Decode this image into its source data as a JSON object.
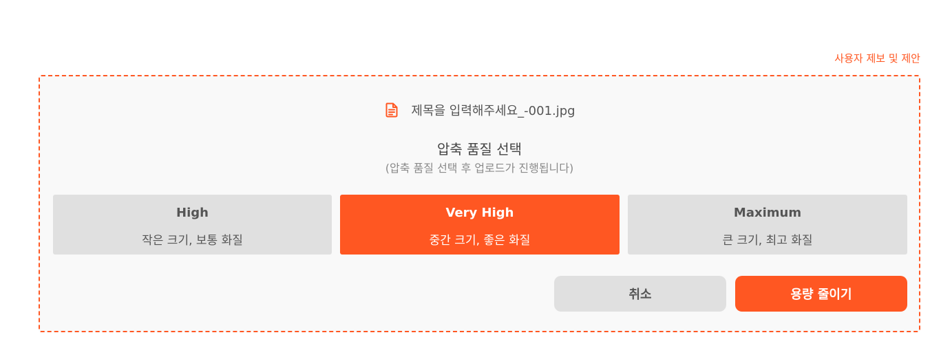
{
  "header": {
    "report_link_label": "사용자 제보 및 제안"
  },
  "file": {
    "icon": "document-icon",
    "name": "제목을 입력해주세요_-001.jpg"
  },
  "quality_section": {
    "title": "압축 품질 선택",
    "subtitle": "(압축 품질 선택 후 업로드가 진행됩니다)",
    "options": [
      {
        "title": "High",
        "description": "작은 크기, 보통 화질",
        "selected": false
      },
      {
        "title": "Very High",
        "description": "중간 크기, 좋은 화질",
        "selected": true
      },
      {
        "title": "Maximum",
        "description": "큰 크기, 최고 화질",
        "selected": false
      }
    ]
  },
  "actions": {
    "cancel_label": "취소",
    "compress_label": "용량 줄이기"
  },
  "colors": {
    "accent": "#ff5722",
    "option_bg": "#e0e0e0",
    "panel_bg": "#f9f9f9"
  }
}
